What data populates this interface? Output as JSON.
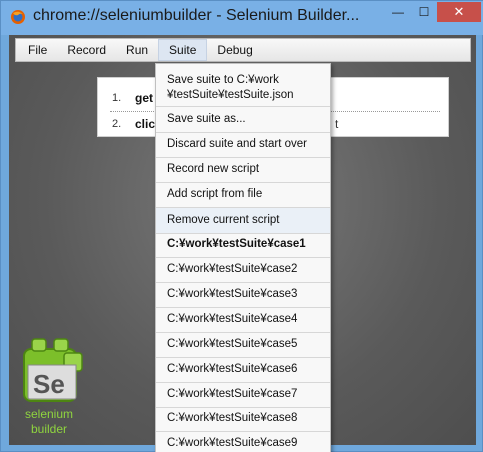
{
  "window": {
    "title": "chrome://seleniumbuilder - Selenium Builder...",
    "minimize_glyph": "—",
    "maximize_glyph": "☐",
    "close_glyph": "✕"
  },
  "menubar": {
    "items": [
      "File",
      "Record",
      "Run",
      "Suite",
      "Debug"
    ]
  },
  "script": {
    "steps": [
      {
        "num": "1.",
        "text": "get",
        "tail": ""
      },
      {
        "num": "2.",
        "text": "clic",
        "tail": "t"
      }
    ]
  },
  "logo": {
    "mark": "Se",
    "caption_line1": "selenium",
    "caption_line2": "builder"
  },
  "suite_menu": {
    "save_suite_to": "Save suite to C:¥work ¥testSuite¥testSuite.json",
    "save_suite_as": "Save suite as...",
    "discard": "Discard suite and start over",
    "record_new": "Record new script",
    "add_from_file": "Add script from file",
    "remove_current": "Remove current script",
    "scripts": [
      "C:¥work¥testSuite¥case1",
      "C:¥work¥testSuite¥case2",
      "C:¥work¥testSuite¥case3",
      "C:¥work¥testSuite¥case4",
      "C:¥work¥testSuite¥case5",
      "C:¥work¥testSuite¥case6",
      "C:¥work¥testSuite¥case7",
      "C:¥work¥testSuite¥case8",
      "C:¥work¥testSuite¥case9"
    ]
  },
  "colors": {
    "logo_green": "#8fd43f",
    "close_red": "#c7504a",
    "titlebar_blue": "#79b0e6"
  }
}
